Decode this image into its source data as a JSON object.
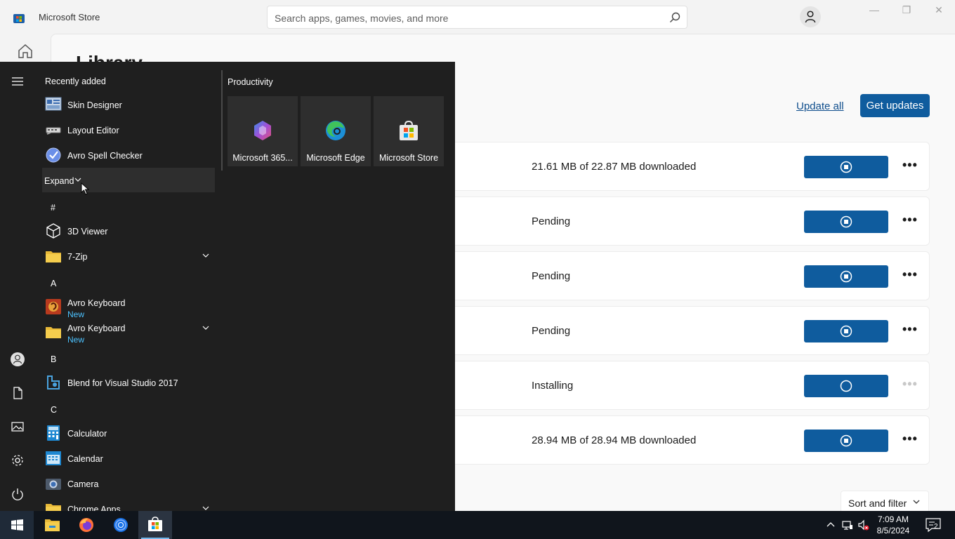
{
  "window": {
    "title": "Microsoft Store",
    "search_placeholder": "Search apps, games, movies, and more",
    "controls": {
      "minimize": "—",
      "restore": "❐",
      "close": "✕"
    }
  },
  "library": {
    "title": "Library",
    "update_all": "Update all",
    "get_updates": "Get updates",
    "sort_filter": "Sort and filter",
    "rows": [
      {
        "status": "21.61 MB of 22.87 MB downloaded",
        "action_icon": "stop-icon",
        "more": "•••"
      },
      {
        "status": "Pending",
        "action_icon": "stop-icon",
        "more": "•••"
      },
      {
        "status": "Pending",
        "action_icon": "stop-icon",
        "more": "•••"
      },
      {
        "status": "Pending",
        "action_icon": "stop-icon",
        "more": "•••"
      },
      {
        "status": "Installing",
        "action_icon": "spinner-icon",
        "more": "•••"
      },
      {
        "status": "28.94 MB of 28.94 MB downloaded",
        "action_icon": "stop-icon",
        "more": "•••"
      }
    ]
  },
  "start_menu": {
    "recently_added_label": "Recently added",
    "recent": [
      {
        "name": "Skin Designer",
        "icon": "skin-designer-icon"
      },
      {
        "name": "Layout Editor",
        "icon": "layout-editor-icon"
      },
      {
        "name": "Avro Spell Checker",
        "icon": "avro-spell-checker-icon"
      }
    ],
    "expand_label": "Expand",
    "groups": [
      {
        "letter": "#",
        "apps": [
          {
            "name": "3D Viewer",
            "icon": "3d-viewer-icon"
          },
          {
            "name": "7-Zip",
            "icon": "folder-icon",
            "expandable": true
          }
        ]
      },
      {
        "letter": "A",
        "apps": [
          {
            "name": "Avro Keyboard",
            "sub": "New",
            "icon": "avro-keyboard-icon"
          },
          {
            "name": "Avro Keyboard",
            "sub": "New",
            "icon": "folder-icon",
            "expandable": true
          }
        ]
      },
      {
        "letter": "B",
        "apps": [
          {
            "name": "Blend for Visual Studio 2017",
            "icon": "blend-icon"
          }
        ]
      },
      {
        "letter": "C",
        "apps": [
          {
            "name": "Calculator",
            "icon": "calculator-icon"
          },
          {
            "name": "Calendar",
            "icon": "calendar-icon"
          },
          {
            "name": "Camera",
            "icon": "camera-icon"
          },
          {
            "name": "Chrome Apps",
            "icon": "folder-icon",
            "expandable": true
          }
        ]
      }
    ],
    "productivity_label": "Productivity",
    "tiles": [
      {
        "name": "Microsoft 365...",
        "icon": "microsoft-365-icon"
      },
      {
        "name": "Microsoft Edge",
        "icon": "edge-icon"
      },
      {
        "name": "Microsoft Store",
        "icon": "store-icon"
      }
    ]
  },
  "taskbar": {
    "apps": [
      "file-explorer-icon",
      "firefox-icon",
      "chrome-icon",
      "store-icon"
    ],
    "time": "7:09 AM",
    "date": "8/5/2024",
    "notification_count": "2"
  },
  "colors": {
    "accent": "#0f5c9e",
    "menu_bg": "#1f1f1f",
    "new_badge": "#4cc2ff",
    "taskbar": "#10151c"
  }
}
